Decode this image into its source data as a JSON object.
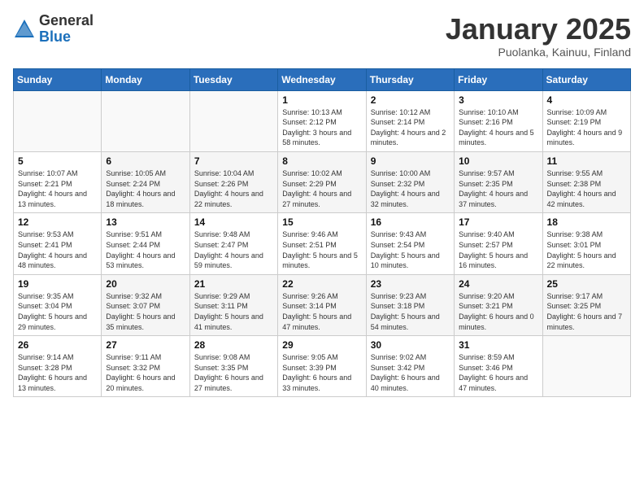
{
  "logo": {
    "general": "General",
    "blue": "Blue"
  },
  "title": "January 2025",
  "location": "Puolanka, Kainuu, Finland",
  "weekdays": [
    "Sunday",
    "Monday",
    "Tuesday",
    "Wednesday",
    "Thursday",
    "Friday",
    "Saturday"
  ],
  "weeks": [
    [
      {
        "day": "",
        "sunrise": "",
        "sunset": "",
        "daylight": ""
      },
      {
        "day": "",
        "sunrise": "",
        "sunset": "",
        "daylight": ""
      },
      {
        "day": "",
        "sunrise": "",
        "sunset": "",
        "daylight": ""
      },
      {
        "day": "1",
        "sunrise": "Sunrise: 10:13 AM",
        "sunset": "Sunset: 2:12 PM",
        "daylight": "Daylight: 3 hours and 58 minutes."
      },
      {
        "day": "2",
        "sunrise": "Sunrise: 10:12 AM",
        "sunset": "Sunset: 2:14 PM",
        "daylight": "Daylight: 4 hours and 2 minutes."
      },
      {
        "day": "3",
        "sunrise": "Sunrise: 10:10 AM",
        "sunset": "Sunset: 2:16 PM",
        "daylight": "Daylight: 4 hours and 5 minutes."
      },
      {
        "day": "4",
        "sunrise": "Sunrise: 10:09 AM",
        "sunset": "Sunset: 2:19 PM",
        "daylight": "Daylight: 4 hours and 9 minutes."
      }
    ],
    [
      {
        "day": "5",
        "sunrise": "Sunrise: 10:07 AM",
        "sunset": "Sunset: 2:21 PM",
        "daylight": "Daylight: 4 hours and 13 minutes."
      },
      {
        "day": "6",
        "sunrise": "Sunrise: 10:05 AM",
        "sunset": "Sunset: 2:24 PM",
        "daylight": "Daylight: 4 hours and 18 minutes."
      },
      {
        "day": "7",
        "sunrise": "Sunrise: 10:04 AM",
        "sunset": "Sunset: 2:26 PM",
        "daylight": "Daylight: 4 hours and 22 minutes."
      },
      {
        "day": "8",
        "sunrise": "Sunrise: 10:02 AM",
        "sunset": "Sunset: 2:29 PM",
        "daylight": "Daylight: 4 hours and 27 minutes."
      },
      {
        "day": "9",
        "sunrise": "Sunrise: 10:00 AM",
        "sunset": "Sunset: 2:32 PM",
        "daylight": "Daylight: 4 hours and 32 minutes."
      },
      {
        "day": "10",
        "sunrise": "Sunrise: 9:57 AM",
        "sunset": "Sunset: 2:35 PM",
        "daylight": "Daylight: 4 hours and 37 minutes."
      },
      {
        "day": "11",
        "sunrise": "Sunrise: 9:55 AM",
        "sunset": "Sunset: 2:38 PM",
        "daylight": "Daylight: 4 hours and 42 minutes."
      }
    ],
    [
      {
        "day": "12",
        "sunrise": "Sunrise: 9:53 AM",
        "sunset": "Sunset: 2:41 PM",
        "daylight": "Daylight: 4 hours and 48 minutes."
      },
      {
        "day": "13",
        "sunrise": "Sunrise: 9:51 AM",
        "sunset": "Sunset: 2:44 PM",
        "daylight": "Daylight: 4 hours and 53 minutes."
      },
      {
        "day": "14",
        "sunrise": "Sunrise: 9:48 AM",
        "sunset": "Sunset: 2:47 PM",
        "daylight": "Daylight: 4 hours and 59 minutes."
      },
      {
        "day": "15",
        "sunrise": "Sunrise: 9:46 AM",
        "sunset": "Sunset: 2:51 PM",
        "daylight": "Daylight: 5 hours and 5 minutes."
      },
      {
        "day": "16",
        "sunrise": "Sunrise: 9:43 AM",
        "sunset": "Sunset: 2:54 PM",
        "daylight": "Daylight: 5 hours and 10 minutes."
      },
      {
        "day": "17",
        "sunrise": "Sunrise: 9:40 AM",
        "sunset": "Sunset: 2:57 PM",
        "daylight": "Daylight: 5 hours and 16 minutes."
      },
      {
        "day": "18",
        "sunrise": "Sunrise: 9:38 AM",
        "sunset": "Sunset: 3:01 PM",
        "daylight": "Daylight: 5 hours and 22 minutes."
      }
    ],
    [
      {
        "day": "19",
        "sunrise": "Sunrise: 9:35 AM",
        "sunset": "Sunset: 3:04 PM",
        "daylight": "Daylight: 5 hours and 29 minutes."
      },
      {
        "day": "20",
        "sunrise": "Sunrise: 9:32 AM",
        "sunset": "Sunset: 3:07 PM",
        "daylight": "Daylight: 5 hours and 35 minutes."
      },
      {
        "day": "21",
        "sunrise": "Sunrise: 9:29 AM",
        "sunset": "Sunset: 3:11 PM",
        "daylight": "Daylight: 5 hours and 41 minutes."
      },
      {
        "day": "22",
        "sunrise": "Sunrise: 9:26 AM",
        "sunset": "Sunset: 3:14 PM",
        "daylight": "Daylight: 5 hours and 47 minutes."
      },
      {
        "day": "23",
        "sunrise": "Sunrise: 9:23 AM",
        "sunset": "Sunset: 3:18 PM",
        "daylight": "Daylight: 5 hours and 54 minutes."
      },
      {
        "day": "24",
        "sunrise": "Sunrise: 9:20 AM",
        "sunset": "Sunset: 3:21 PM",
        "daylight": "Daylight: 6 hours and 0 minutes."
      },
      {
        "day": "25",
        "sunrise": "Sunrise: 9:17 AM",
        "sunset": "Sunset: 3:25 PM",
        "daylight": "Daylight: 6 hours and 7 minutes."
      }
    ],
    [
      {
        "day": "26",
        "sunrise": "Sunrise: 9:14 AM",
        "sunset": "Sunset: 3:28 PM",
        "daylight": "Daylight: 6 hours and 13 minutes."
      },
      {
        "day": "27",
        "sunrise": "Sunrise: 9:11 AM",
        "sunset": "Sunset: 3:32 PM",
        "daylight": "Daylight: 6 hours and 20 minutes."
      },
      {
        "day": "28",
        "sunrise": "Sunrise: 9:08 AM",
        "sunset": "Sunset: 3:35 PM",
        "daylight": "Daylight: 6 hours and 27 minutes."
      },
      {
        "day": "29",
        "sunrise": "Sunrise: 9:05 AM",
        "sunset": "Sunset: 3:39 PM",
        "daylight": "Daylight: 6 hours and 33 minutes."
      },
      {
        "day": "30",
        "sunrise": "Sunrise: 9:02 AM",
        "sunset": "Sunset: 3:42 PM",
        "daylight": "Daylight: 6 hours and 40 minutes."
      },
      {
        "day": "31",
        "sunrise": "Sunrise: 8:59 AM",
        "sunset": "Sunset: 3:46 PM",
        "daylight": "Daylight: 6 hours and 47 minutes."
      },
      {
        "day": "",
        "sunrise": "",
        "sunset": "",
        "daylight": ""
      }
    ]
  ]
}
